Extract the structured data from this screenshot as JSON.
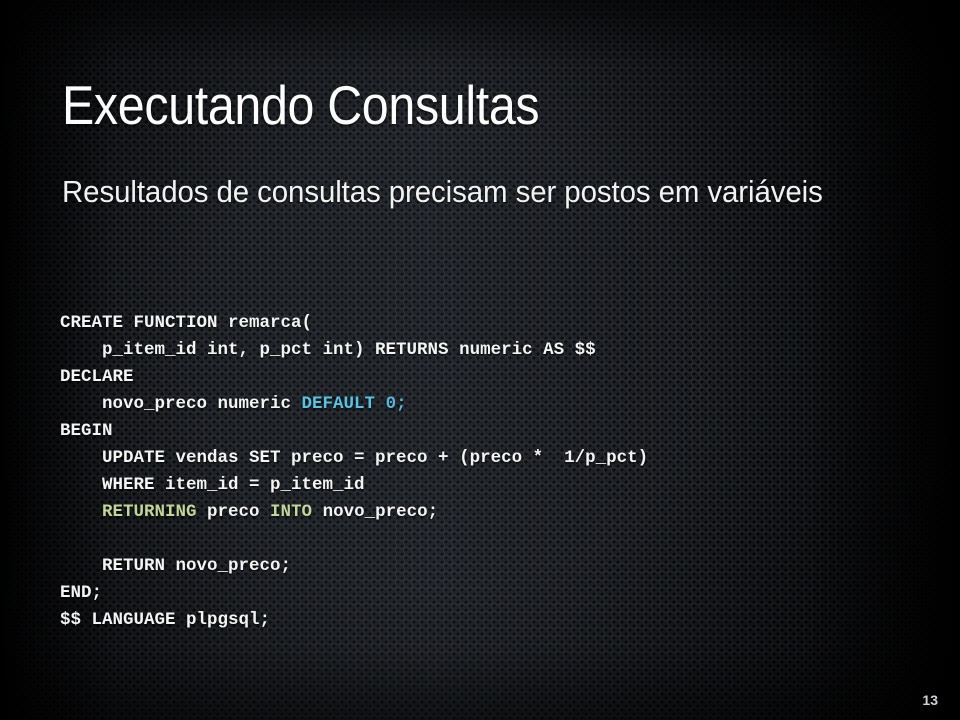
{
  "slide": {
    "title": "Executando Consultas",
    "subtitle": "Resultados de consultas precisam ser postos em variáveis",
    "page_number": "13",
    "background": {
      "base_color": "#16181c",
      "texture": "perforated-carbon-grid",
      "vignette": true
    }
  },
  "code": {
    "language": "plpgsql",
    "full_text": "CREATE FUNCTION remarca(\n    p_item_id int, p_pct int) RETURNS numeric AS $$\nDECLARE\n    novo_preco numeric DEFAULT 0;\nBEGIN\n    UPDATE vendas SET preco = preco + (preco *  1/p_pct)\n    WHERE item_id = p_item_id\n    RETURNING preco INTO novo_preco;\n\n    RETURN novo_preco;\nEND;\n$$ LANGUAGE plpgsql;",
    "colors": {
      "default_text": "#f4f4f4",
      "keyword_cyan": "#58c4e4",
      "number": "#58b8e0",
      "keyword_olive": "#c2d69a"
    },
    "lines": [
      {
        "segments": [
          {
            "text": "CREATE FUNCTION remarca(",
            "style": "plain"
          }
        ]
      },
      {
        "segments": [
          {
            "text": "    p_item_id int, p_pct int) RETURNS numeric AS $$",
            "style": "plain"
          }
        ]
      },
      {
        "segments": [
          {
            "text": "DECLARE",
            "style": "plain"
          }
        ]
      },
      {
        "segments": [
          {
            "text": "    novo_preco numeric ",
            "style": "plain"
          },
          {
            "text": "DEFAULT",
            "style": "kw-cyan"
          },
          {
            "text": " ",
            "style": "plain"
          },
          {
            "text": "0",
            "style": "num"
          },
          {
            "text": ";",
            "style": "num"
          }
        ]
      },
      {
        "segments": [
          {
            "text": "BEGIN",
            "style": "plain"
          }
        ]
      },
      {
        "segments": [
          {
            "text": "    UPDATE vendas SET preco = preco + (preco *  1/p_pct)",
            "style": "plain"
          }
        ]
      },
      {
        "segments": [
          {
            "text": "    WHERE item_id = p_item_id",
            "style": "plain"
          }
        ]
      },
      {
        "segments": [
          {
            "text": "    ",
            "style": "plain"
          },
          {
            "text": "RETURNING",
            "style": "kw-olive"
          },
          {
            "text": " preco ",
            "style": "plain"
          },
          {
            "text": "INTO",
            "style": "kw-olive"
          },
          {
            "text": " novo_preco;",
            "style": "plain"
          }
        ]
      },
      {
        "segments": [
          {
            "text": "",
            "style": "plain"
          }
        ]
      },
      {
        "segments": [
          {
            "text": "    RETURN novo_preco;",
            "style": "plain"
          }
        ]
      },
      {
        "segments": [
          {
            "text": "END;",
            "style": "plain"
          }
        ]
      },
      {
        "segments": [
          {
            "text": "$$ LANGUAGE plpgsql;",
            "style": "plain"
          }
        ]
      }
    ]
  }
}
